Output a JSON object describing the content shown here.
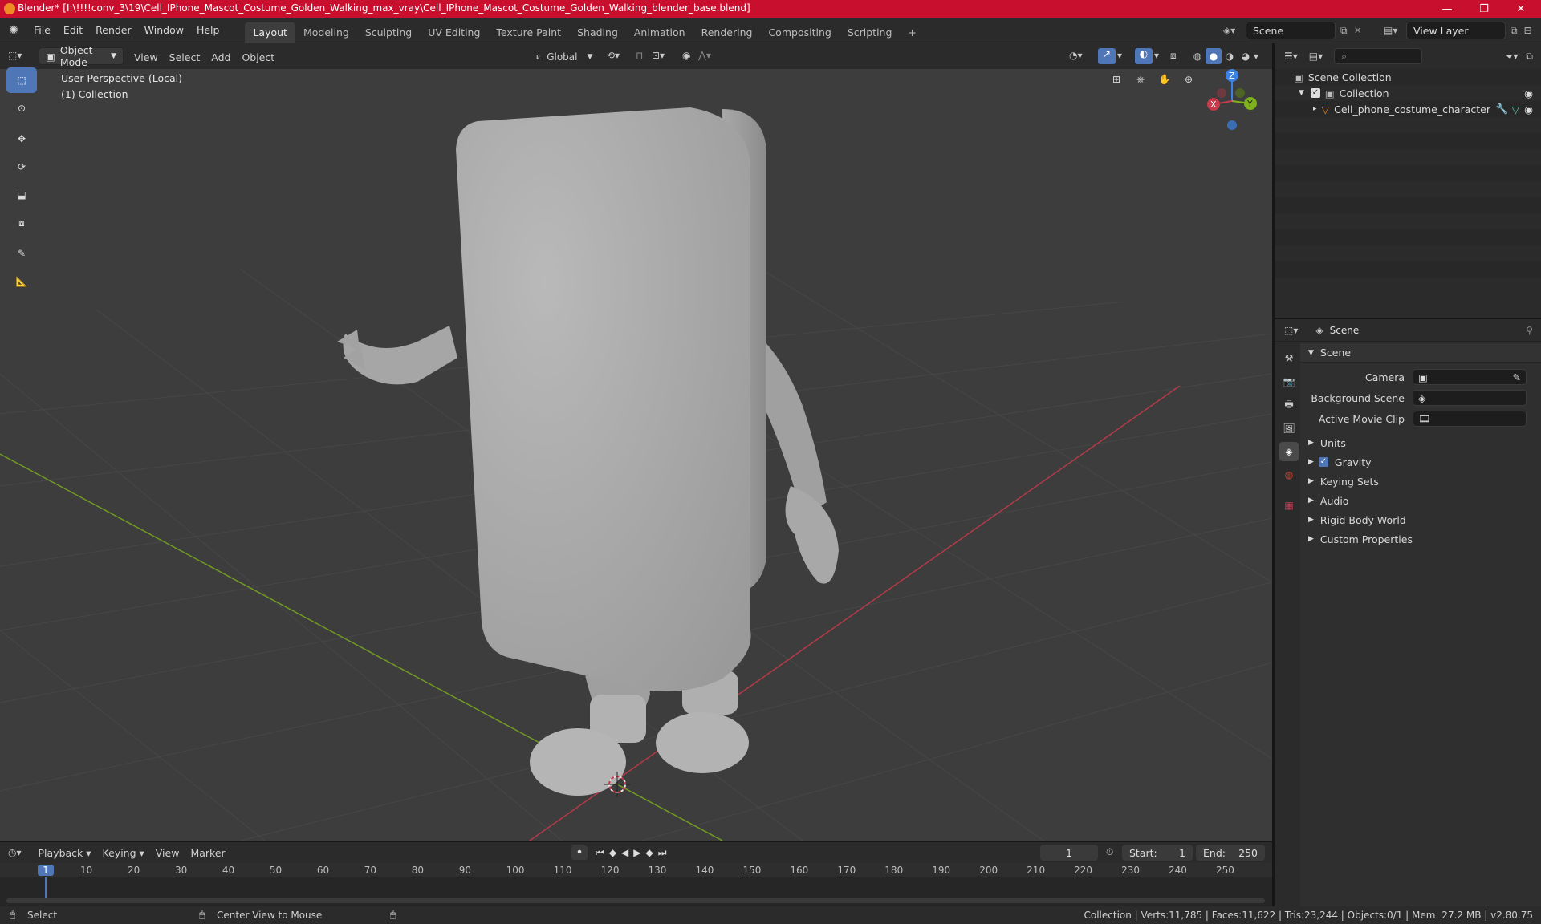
{
  "titlebar": {
    "title": "Blender* [I:\\!!!!conv_3\\19\\Cell_IPhone_Mascot_Costume_Golden_Walking_max_vray\\Cell_IPhone_Mascot_Costume_Golden_Walking_blender_base.blend]",
    "minimize": "—",
    "maximize": "❐",
    "close": "✕"
  },
  "menu": [
    "File",
    "Edit",
    "Render",
    "Window",
    "Help"
  ],
  "workspaces": [
    "Layout",
    "Modeling",
    "Sculpting",
    "UV Editing",
    "Texture Paint",
    "Shading",
    "Animation",
    "Rendering",
    "Compositing",
    "Scripting"
  ],
  "scene_field": "Scene",
  "view_layer_field": "View Layer",
  "viewport_header": {
    "mode": "Object Mode",
    "menus": [
      "View",
      "Select",
      "Add",
      "Object"
    ],
    "transform": "Global"
  },
  "overlay": {
    "perspective": "User Perspective (Local)",
    "collection": "(1) Collection"
  },
  "gizmo": {
    "z": "Z",
    "x": "X",
    "y": "Y"
  },
  "outliner": {
    "root": "Scene Collection",
    "collection": "Collection",
    "object": "Cell_phone_costume_character"
  },
  "properties": {
    "header": "Scene",
    "section": "Scene",
    "camera_label": "Camera",
    "bg_label": "Background Scene",
    "clip_label": "Active Movie Clip",
    "panels": [
      "Units",
      "Gravity",
      "Keying Sets",
      "Audio",
      "Rigid Body World",
      "Custom Properties"
    ]
  },
  "timeline": {
    "menus": [
      "Playback",
      "Keying",
      "View",
      "Marker"
    ],
    "current_frame": "1",
    "start_label": "Start:",
    "start": "1",
    "end_label": "End:",
    "end": "250",
    "ruler": [
      "1",
      "10",
      "20",
      "30",
      "40",
      "50",
      "60",
      "70",
      "80",
      "90",
      "100",
      "110",
      "120",
      "130",
      "140",
      "150",
      "160",
      "170",
      "180",
      "190",
      "200",
      "210",
      "220",
      "230",
      "240",
      "250"
    ]
  },
  "status": {
    "select": "Select",
    "center": "Center View to Mouse",
    "stats": "Collection | Verts:11,785 | Faces:11,622 | Tris:23,244 | Objects:0/1 | Mem: 27.2 MB | v2.80.75"
  },
  "colors": {
    "accent": "#4f77b8",
    "titlebar": "#c8102e",
    "x_axis": "#c83a4a",
    "y_axis": "#7fb21d",
    "z_axis": "#3b82e4"
  }
}
